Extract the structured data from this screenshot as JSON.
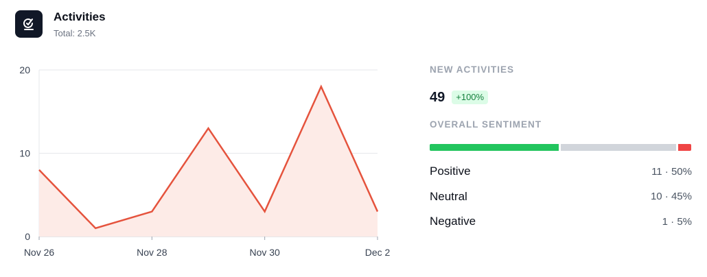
{
  "header": {
    "title": "Activities",
    "subtitle": "Total: 2.5K",
    "icon": "activity-icon"
  },
  "chart_data": {
    "type": "area",
    "x": [
      "Nov 26",
      "Nov 27",
      "Nov 28",
      "Nov 29",
      "Nov 30",
      "Dec 1",
      "Dec 2"
    ],
    "x_tick_labels": [
      "Nov 26",
      "Nov 28",
      "Nov 30",
      "Dec 2"
    ],
    "values": [
      8,
      1,
      3,
      13,
      3,
      18,
      3
    ],
    "ylim": [
      0,
      20
    ],
    "y_ticks": [
      0,
      10,
      20
    ],
    "grid": true,
    "colors": {
      "line": "#e5533d",
      "fill": "#fdebe7"
    }
  },
  "summary": {
    "new_activities_label": "NEW ACTIVITIES",
    "new_activities_value": "49",
    "new_activities_change": "+100%",
    "sentiment_label": "OVERALL SENTIMENT",
    "sentiment": [
      {
        "label": "Positive",
        "value": "11 · 50%",
        "share": 0.5,
        "color": "#22c55e"
      },
      {
        "label": "Neutral",
        "value": "10 · 45%",
        "share": 0.45,
        "color": "#d1d5db"
      },
      {
        "label": "Negative",
        "value": "1 · 5%",
        "share": 0.05,
        "color": "#ef4444"
      }
    ]
  }
}
